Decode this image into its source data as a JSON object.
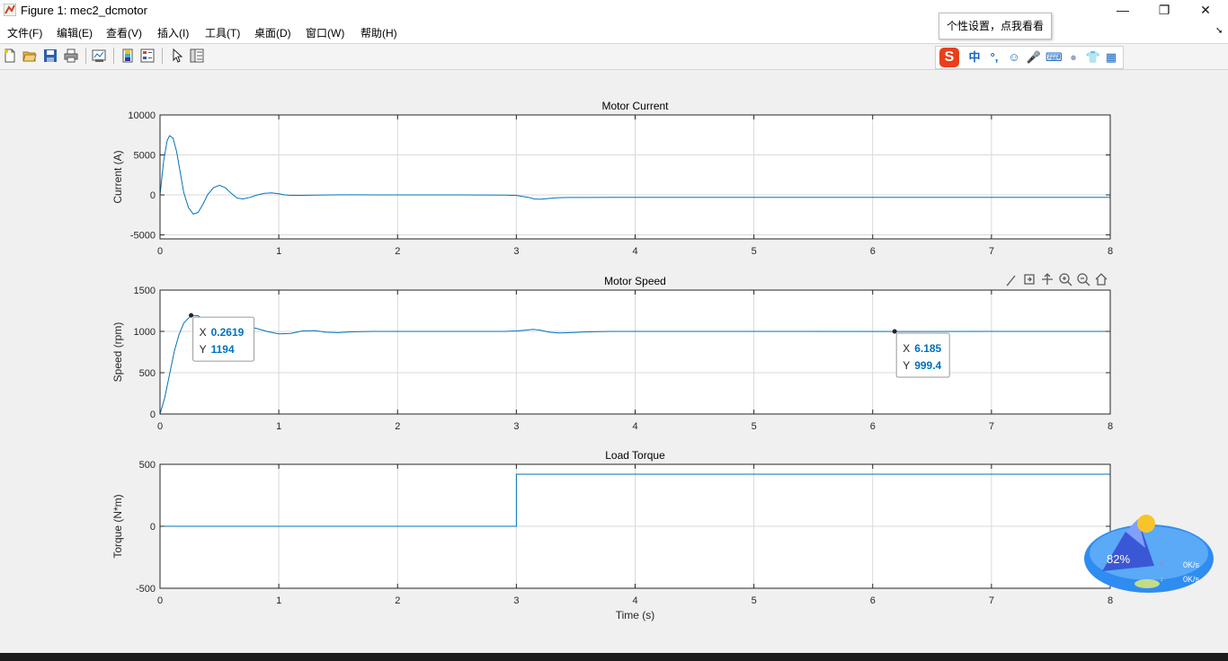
{
  "window": {
    "title": "Figure 1: mec2_dcmotor",
    "controls": {
      "minimize": "—",
      "restore": "❐",
      "close": "✕"
    }
  },
  "menu": {
    "items": [
      "文件(F)",
      "编辑(E)",
      "查看(V)",
      "插入(I)",
      "工具(T)",
      "桌面(D)",
      "窗口(W)",
      "帮助(H)"
    ]
  },
  "toolbar": {
    "buttons": [
      "new-figure",
      "open-file",
      "save",
      "print",
      "link-plot",
      "insert-colorbar",
      "insert-legend",
      "edit-plot-pointer",
      "property-inspector"
    ]
  },
  "ime": {
    "tooltip": "个性设置，点我看看",
    "logo": "S",
    "mode": "中",
    "punct": "°,"
  },
  "axes_toolbar": [
    "brush-icon",
    "export-icon",
    "pan-icon",
    "zoom-in-icon",
    "zoom-out-icon",
    "home-icon"
  ],
  "colors": {
    "line": "#0072bd",
    "datatip_value": "#0072bd",
    "grid": "#d9d9d9",
    "axes_bg": "#ffffff"
  },
  "chart_data": [
    {
      "type": "line",
      "title": "Motor Current",
      "xlabel": "",
      "ylabel": "Current (A)",
      "xlim": [
        0,
        8
      ],
      "ylim": [
        -5500,
        10000
      ],
      "xticks": [
        "0",
        "1",
        "2",
        "3",
        "4",
        "5",
        "6",
        "7",
        "8"
      ],
      "yticks": [
        "-5000",
        "0",
        "5000",
        "10000"
      ],
      "ytick_values": [
        -5000,
        0,
        5000,
        10000
      ],
      "grid": true,
      "series": [
        {
          "x": [
            0,
            0.03,
            0.06,
            0.08,
            0.11,
            0.14,
            0.17,
            0.2,
            0.24,
            0.28,
            0.32,
            0.36,
            0.4,
            0.45,
            0.5,
            0.55,
            0.6,
            0.65,
            0.7,
            0.76,
            0.82,
            0.88,
            0.94,
            1.0,
            1.05,
            1.1,
            1.2,
            1.3,
            1.45,
            1.6,
            1.8,
            2.0,
            2.5,
            2.9,
            3.0,
            3.1,
            3.15,
            3.2,
            3.25,
            3.35,
            3.45,
            3.6,
            3.8,
            4.0,
            5.0,
            6.0,
            7.0,
            8.0
          ],
          "y": [
            0,
            4200,
            6800,
            7400,
            7100,
            5400,
            2800,
            300,
            -1600,
            -2400,
            -2200,
            -1200,
            0,
            900,
            1200,
            900,
            200,
            -400,
            -500,
            -300,
            0,
            200,
            250,
            150,
            0,
            -50,
            -50,
            -20,
            0,
            10,
            0,
            0,
            0,
            -20,
            -60,
            -300,
            -500,
            -550,
            -480,
            -350,
            -320,
            -320,
            -300,
            -300,
            -300,
            -300,
            -300,
            -300
          ]
        }
      ]
    },
    {
      "type": "line",
      "title": "Motor Speed",
      "xlabel": "",
      "ylabel": "Speed (rpm)",
      "xlim": [
        0,
        8
      ],
      "ylim": [
        0,
        1500
      ],
      "xticks": [
        "0",
        "1",
        "2",
        "3",
        "4",
        "5",
        "6",
        "7",
        "8"
      ],
      "yticks": [
        "0",
        "500",
        "1000",
        "1500"
      ],
      "ytick_values": [
        0,
        500,
        1000,
        1500
      ],
      "grid": true,
      "series": [
        {
          "x": [
            0,
            0.04,
            0.08,
            0.12,
            0.16,
            0.2,
            0.2619,
            0.32,
            0.38,
            0.45,
            0.52,
            0.6,
            0.7,
            0.8,
            0.9,
            1.0,
            1.1,
            1.2,
            1.3,
            1.4,
            1.5,
            1.6,
            1.8,
            2.0,
            2.5,
            2.9,
            3.0,
            3.08,
            3.14,
            3.2,
            3.28,
            3.36,
            3.45,
            3.6,
            3.8,
            4.0,
            5.0,
            6.185,
            7.0,
            8.0
          ],
          "y": [
            0,
            200,
            480,
            760,
            960,
            1100,
            1194,
            1190,
            1130,
            1060,
            1010,
            1000,
            1020,
            1040,
            1000,
            970,
            975,
            1005,
            1010,
            990,
            985,
            995,
            1000,
            1000,
            1000,
            1000,
            1005,
            1015,
            1025,
            1015,
            990,
            980,
            985,
            995,
            1000,
            1000,
            1000,
            999.4,
            1000,
            1000
          ]
        }
      ],
      "datatips": [
        {
          "x_label": "X",
          "x_value": "0.2619",
          "y_label": "Y",
          "y_value": "1194",
          "x": 0.2619,
          "y": 1194
        },
        {
          "x_label": "X",
          "x_value": "6.185",
          "y_label": "Y",
          "y_value": "999.4",
          "x": 6.185,
          "y": 999.4
        }
      ]
    },
    {
      "type": "line",
      "title": "Load Torque",
      "xlabel": "Time (s)",
      "ylabel": "Torque (N*m)",
      "xlim": [
        0,
        8
      ],
      "ylim": [
        -500,
        500
      ],
      "xticks": [
        "0",
        "1",
        "2",
        "3",
        "4",
        "5",
        "6",
        "7",
        "8"
      ],
      "yticks": [
        "-500",
        "0",
        "500"
      ],
      "ytick_values": [
        -500,
        0,
        500
      ],
      "grid": true,
      "series": [
        {
          "x": [
            0,
            3,
            3,
            8
          ],
          "y": [
            0,
            0,
            420,
            420
          ]
        }
      ]
    }
  ],
  "net_widget": {
    "percent": "82%",
    "upload": "0K/s",
    "download": "0K/s"
  }
}
